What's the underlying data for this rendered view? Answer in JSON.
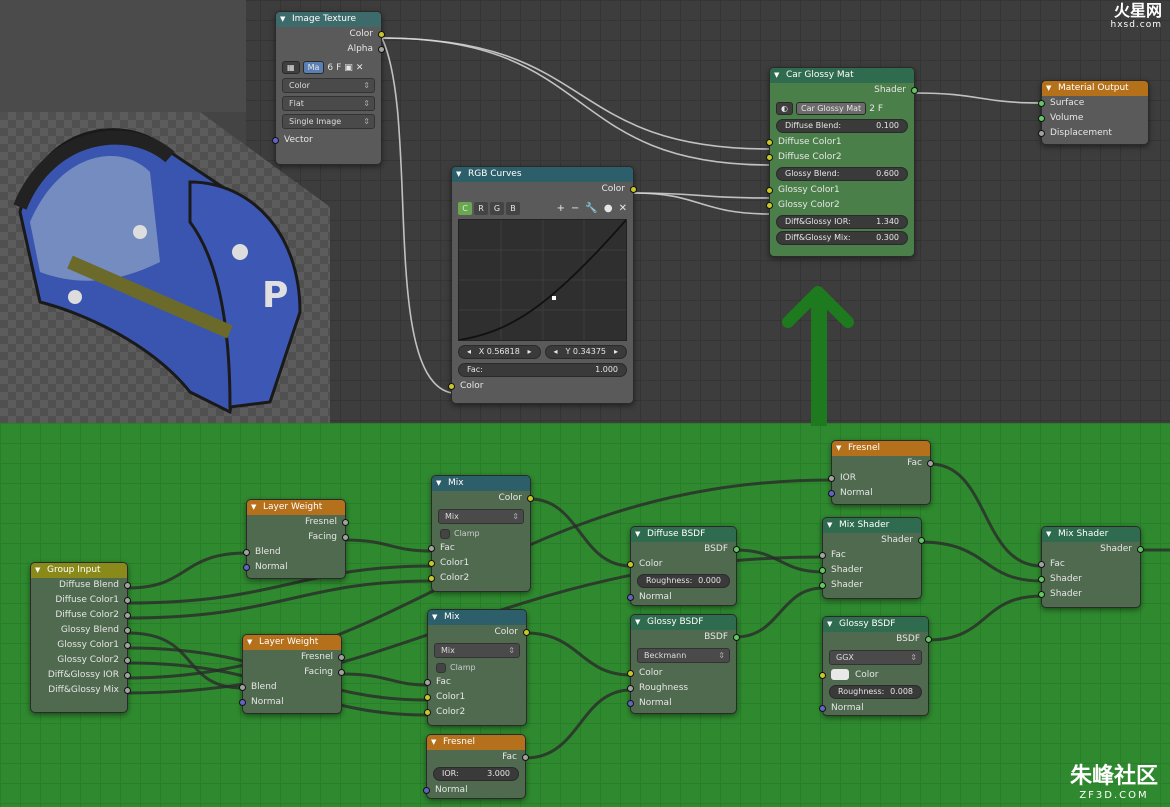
{
  "watermark_top": {
    "logo": "火星网",
    "url": "hxsd.com"
  },
  "watermark_bottom": {
    "logo": "朱峰社区",
    "url": "ZF3D.COM"
  },
  "image_texture": {
    "title": "Image Texture",
    "out_color": "Color",
    "out_alpha": "Alpha",
    "img_field": "Ma",
    "img_users": "6",
    "img_fake": "F",
    "color_mode": "Color",
    "projection": "Flat",
    "source": "Single Image",
    "in_vector": "Vector"
  },
  "rgb_curves": {
    "title": "RGB Curves",
    "out_color": "Color",
    "ch_c": "C",
    "ch_r": "R",
    "ch_g": "G",
    "ch_b": "B",
    "x_label": "X 0.56818",
    "y_label": "Y 0.34375",
    "fac_label": "Fac:",
    "fac_value": "1.000",
    "in_color": "Color"
  },
  "car_glossy": {
    "title": "Car Glossy Mat",
    "out_shader": "Shader",
    "group_name": "Car Glossy Mat",
    "users": "2",
    "fake": "F",
    "diffuse_blend_label": "Diffuse Blend:",
    "diffuse_blend": "0.100",
    "diffuse_color1": "Diffuse Color1",
    "diffuse_color2": "Diffuse Color2",
    "glossy_blend_label": "Glossy Blend:",
    "glossy_blend": "0.600",
    "glossy_color1": "Glossy Color1",
    "glossy_color2": "Glossy Color2",
    "ior_label": "Diff&Glossy IOR:",
    "ior": "1.340",
    "mix_label": "Diff&Glossy Mix:",
    "mix": "0.300"
  },
  "material_output": {
    "title": "Material Output",
    "surface": "Surface",
    "volume": "Volume",
    "displacement": "Displacement"
  },
  "group_input": {
    "title": "Group Input",
    "items": [
      "Diffuse Blend",
      "Diffuse Color1",
      "Diffuse Color2",
      "Glossy Blend",
      "Glossy Color1",
      "Glossy Color2",
      "Diff&Glossy IOR",
      "Diff&Glossy Mix"
    ]
  },
  "layer_weight_1": {
    "title": "Layer Weight",
    "fresnel": "Fresnel",
    "facing": "Facing",
    "blend": "Blend",
    "normal": "Normal"
  },
  "layer_weight_2": {
    "title": "Layer Weight",
    "fresnel": "Fresnel",
    "facing": "Facing",
    "blend": "Blend",
    "normal": "Normal"
  },
  "mix_1": {
    "title": "Mix",
    "out_color": "Color",
    "mode": "Mix",
    "clamp": "Clamp",
    "fac": "Fac",
    "color1": "Color1",
    "color2": "Color2"
  },
  "mix_2": {
    "title": "Mix",
    "out_color": "Color",
    "mode": "Mix",
    "clamp": "Clamp",
    "fac": "Fac",
    "color1": "Color1",
    "color2": "Color2"
  },
  "fresnel_top": {
    "title": "Fresnel",
    "fac": "Fac",
    "ior": "IOR",
    "normal": "Normal"
  },
  "fresnel_bottom": {
    "title": "Fresnel",
    "fac": "Fac",
    "ior_label": "IOR:",
    "ior": "3.000",
    "normal": "Normal"
  },
  "diffuse_bsdf": {
    "title": "Diffuse BSDF",
    "out": "BSDF",
    "color": "Color",
    "rough_label": "Roughness:",
    "rough": "0.000",
    "normal": "Normal"
  },
  "glossy_bsdf_1": {
    "title": "Glossy BSDF",
    "out": "BSDF",
    "dist": "Beckmann",
    "color": "Color",
    "roughness": "Roughness",
    "normal": "Normal"
  },
  "glossy_bsdf_2": {
    "title": "Glossy BSDF",
    "out": "BSDF",
    "dist": "GGX",
    "color": "Color",
    "rough_label": "Roughness:",
    "rough": "0.008",
    "normal": "Normal"
  },
  "mix_shader_1": {
    "title": "Mix Shader",
    "out": "Shader",
    "fac": "Fac",
    "shader1": "Shader",
    "shader2": "Shader"
  },
  "mix_shader_2": {
    "title": "Mix Shader",
    "out": "Shader",
    "fac": "Fac",
    "shader1": "Shader",
    "shader2": "Shader"
  },
  "colors": {
    "editor_bg": "#3d3d3d",
    "group_bg": "#2f8a2f",
    "arrow": "#1e7a1e"
  }
}
